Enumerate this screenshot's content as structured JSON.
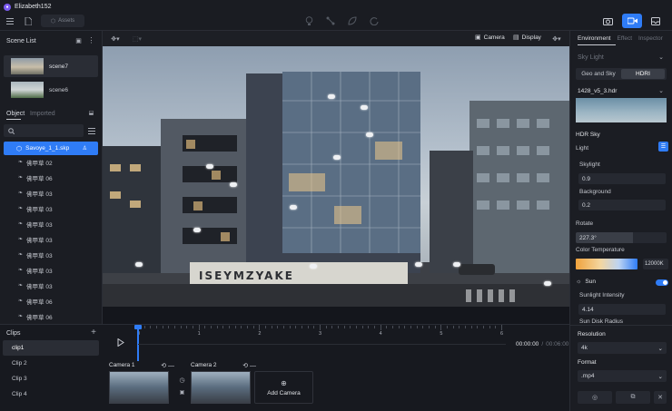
{
  "app": {
    "title": "Elizabeth152",
    "assets_label": "Assets"
  },
  "scene_list": {
    "title": "Scene List",
    "scenes": [
      {
        "label": "scene7"
      },
      {
        "label": "scene6"
      }
    ]
  },
  "object_panel": {
    "tab_object": "Object",
    "tab_imported": "Imported",
    "selected_item": "Savoye_1_1.skp",
    "items": [
      "佛甲草 02",
      "佛甲草 06",
      "佛甲草 03",
      "佛甲草 03",
      "佛甲草 03",
      "佛甲草 03",
      "佛甲草 03",
      "佛甲草 03",
      "佛甲草 03",
      "佛甲草 06",
      "佛甲草 06"
    ]
  },
  "viewport": {
    "camera_label": "Camera",
    "display_label": "Display"
  },
  "building": {
    "sign_text": "ISEYMZYAKE"
  },
  "clips": {
    "title": "Clips",
    "items": [
      "clip1",
      "Clip 2",
      "Clip 3",
      "Clip 4"
    ],
    "selected": "clip1"
  },
  "timeline": {
    "ticks": [
      "0",
      "1",
      "2",
      "3",
      "4",
      "5",
      "6"
    ],
    "current_time": "00:00:00",
    "total_time": "00:06:00",
    "separator": "/"
  },
  "cameras": {
    "items": [
      {
        "label": "Camera 1"
      },
      {
        "label": "Camera 2"
      }
    ],
    "add_label": "Add Camera"
  },
  "inspector": {
    "tabs": [
      "Environment",
      "Effect",
      "Inspector"
    ],
    "active_tab": "Environment",
    "sky_light_title": "Sky Light",
    "mode_geo": "Geo and Sky",
    "mode_hdri": "HDRI",
    "hdr_file": "1428_v5_3.hdr",
    "hdr_sky_title": "HDR Sky",
    "light_label": "Light",
    "skylight_label": "Skylight",
    "skylight_value": "0.9",
    "background_label": "Background",
    "background_value": "0.2",
    "rotate_label": "Rotate",
    "rotate_value": "227.3°",
    "color_temp_label": "Color Temperature",
    "color_temp_value": "12000K",
    "sun_label": "Sun",
    "sunlight_intensity_label": "Sunlight Intensity",
    "sunlight_intensity_value": "4.14",
    "sun_disk_label": "Sun Disk Radius",
    "resolution_label": "Resolution",
    "resolution_value": "4k",
    "format_label": "Format",
    "format_value": ".mp4"
  },
  "colors": {
    "accent": "#2f7cf6",
    "panel": "#1b1d23",
    "background": "#13151b"
  }
}
